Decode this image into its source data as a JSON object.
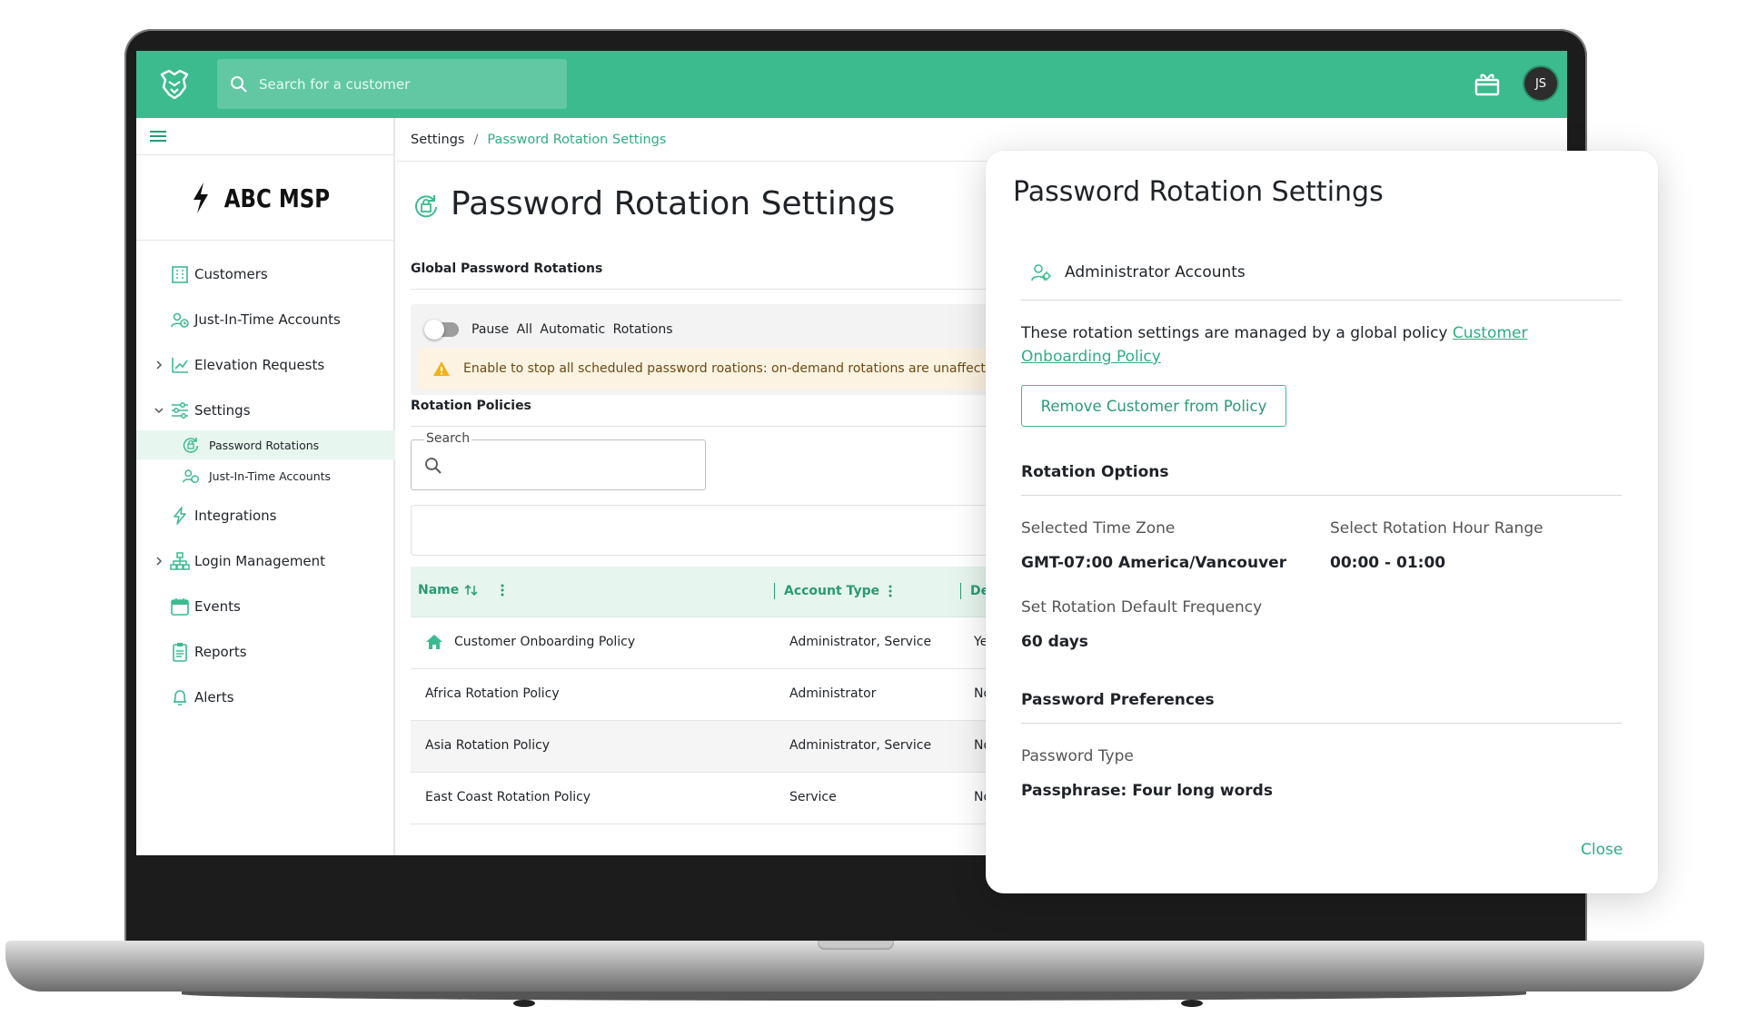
{
  "topbar": {
    "search_placeholder": "Search for a customer",
    "avatar_initials": "JS"
  },
  "sidebar": {
    "brand": "ABC MSP",
    "items": [
      {
        "label": "Customers",
        "icon": "building-icon"
      },
      {
        "label": "Just-In-Time Accounts",
        "icon": "users-clock-icon"
      },
      {
        "label": "Elevation Requests",
        "icon": "chart-up-icon"
      },
      {
        "label": "Settings",
        "icon": "sliders-icon"
      },
      {
        "label": "Password Rotations",
        "icon": "rotate-lock-icon"
      },
      {
        "label": "Just-In-Time Accounts",
        "icon": "users-clock-icon"
      },
      {
        "label": "Integrations",
        "icon": "bolt-icon"
      },
      {
        "label": "Login Management",
        "icon": "sitemap-icon"
      },
      {
        "label": "Events",
        "icon": "calendar-icon"
      },
      {
        "label": "Reports",
        "icon": "clipboard-icon"
      },
      {
        "label": "Alerts",
        "icon": "bell-icon"
      }
    ]
  },
  "breadcrumb": {
    "parent": "Settings",
    "separator": "/",
    "current": "Password Rotation Settings"
  },
  "page": {
    "title": "Password Rotation Settings",
    "global_section": "Global Password Rotations",
    "pause_label": "Pause All Automatic Rotations",
    "warning": "Enable to stop all scheduled password roations: on-demand rotations are unaffected",
    "policies_section": "Rotation Policies",
    "search_label": "Search"
  },
  "table": {
    "columns": [
      "Name",
      "Account Type",
      "Def"
    ],
    "rows": [
      {
        "name": "Customer Onboarding Policy",
        "type": "Administrator, Service",
        "def": "Ye"
      },
      {
        "name": "Africa Rotation Policy",
        "type": "Administrator",
        "def": "No"
      },
      {
        "name": "Asia Rotation Policy",
        "type": "Administrator, Service",
        "def": "No"
      },
      {
        "name": "East Coast Rotation Policy",
        "type": "Service",
        "def": "No"
      }
    ]
  },
  "modal": {
    "title": "Password Rotation Settings",
    "account_group": "Administrator Accounts",
    "managed_text": "These rotation settings are managed by a global policy",
    "managed_link": "Customer Onboarding Policy",
    "remove_button": "Remove Customer from Policy",
    "rotation_options": "Rotation Options",
    "timezone_label": "Selected Time Zone",
    "timezone_value": "GMT-07:00 America/Vancouver",
    "hour_range_label": "Select Rotation Hour Range",
    "hour_range_value": "00:00 - 01:00",
    "frequency_label": "Set Rotation Default Frequency",
    "frequency_value": "60 days",
    "password_prefs": "Password Preferences",
    "password_type_label": "Password Type",
    "password_type_value": "Passphrase: Four long words",
    "close": "Close"
  },
  "colors": {
    "brand_green": "#3bbb8e",
    "link_green": "#2fae80",
    "warning_bg": "#fdf3e2"
  }
}
